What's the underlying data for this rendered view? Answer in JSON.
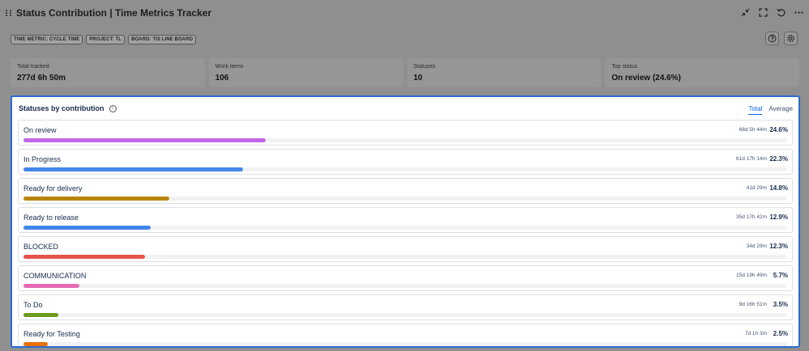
{
  "header": {
    "title": "Status Contribution | Time Metrics Tracker",
    "actions": [
      "minimize-icon",
      "expand-icon",
      "refresh-icon",
      "more-icon"
    ]
  },
  "tags": [
    "TIME METRIC: CYCLE TIME",
    "PROJECT: TL",
    "BOARD: TIS LINE BOARD"
  ],
  "toolbar": {
    "help_icon": "help-icon",
    "settings_icon": "gear-icon"
  },
  "stats": [
    {
      "label": "Total tracked",
      "value": "277d 6h 50m"
    },
    {
      "label": "Work items",
      "value": "106"
    },
    {
      "label": "Statuses",
      "value": "10"
    },
    {
      "label": "Top status",
      "value": "On review (24.6%)"
    }
  ],
  "panel": {
    "title": "Statuses by contribution",
    "tabs": [
      {
        "label": "Total",
        "active": true
      },
      {
        "label": "Average",
        "active": false
      }
    ],
    "rows": [
      {
        "name": "On review",
        "time": "68d 5h 44m",
        "pct": "24.6%",
        "share": 0.246,
        "color": "#c465e8"
      },
      {
        "name": "In Progress",
        "time": "61d 17h 14m",
        "pct": "22.3%",
        "share": 0.223,
        "color": "#4285e8"
      },
      {
        "name": "Ready for delivery",
        "time": "41d 29m",
        "pct": "14.8%",
        "share": 0.148,
        "color": "#b8860b"
      },
      {
        "name": "Ready to release",
        "time": "35d 17h 42m",
        "pct": "12.9%",
        "share": 0.129,
        "color": "#4285e8"
      },
      {
        "name": "BLOCKED",
        "time": "34d 29m",
        "pct": "12.3%",
        "share": 0.123,
        "color": "#e5534b"
      },
      {
        "name": "COMMUNICATION",
        "time": "15d 19h 49m",
        "pct": "5.7%",
        "share": 0.057,
        "color": "#e66bb4"
      },
      {
        "name": "To Do",
        "time": "9d 16h 51m",
        "pct": "3.5%",
        "share": 0.035,
        "color": "#6a9a1f"
      },
      {
        "name": "Ready for Testing",
        "time": "7d 1h 3m",
        "pct": "2.5%",
        "share": 0.025,
        "color": "#e8710a"
      }
    ]
  }
}
